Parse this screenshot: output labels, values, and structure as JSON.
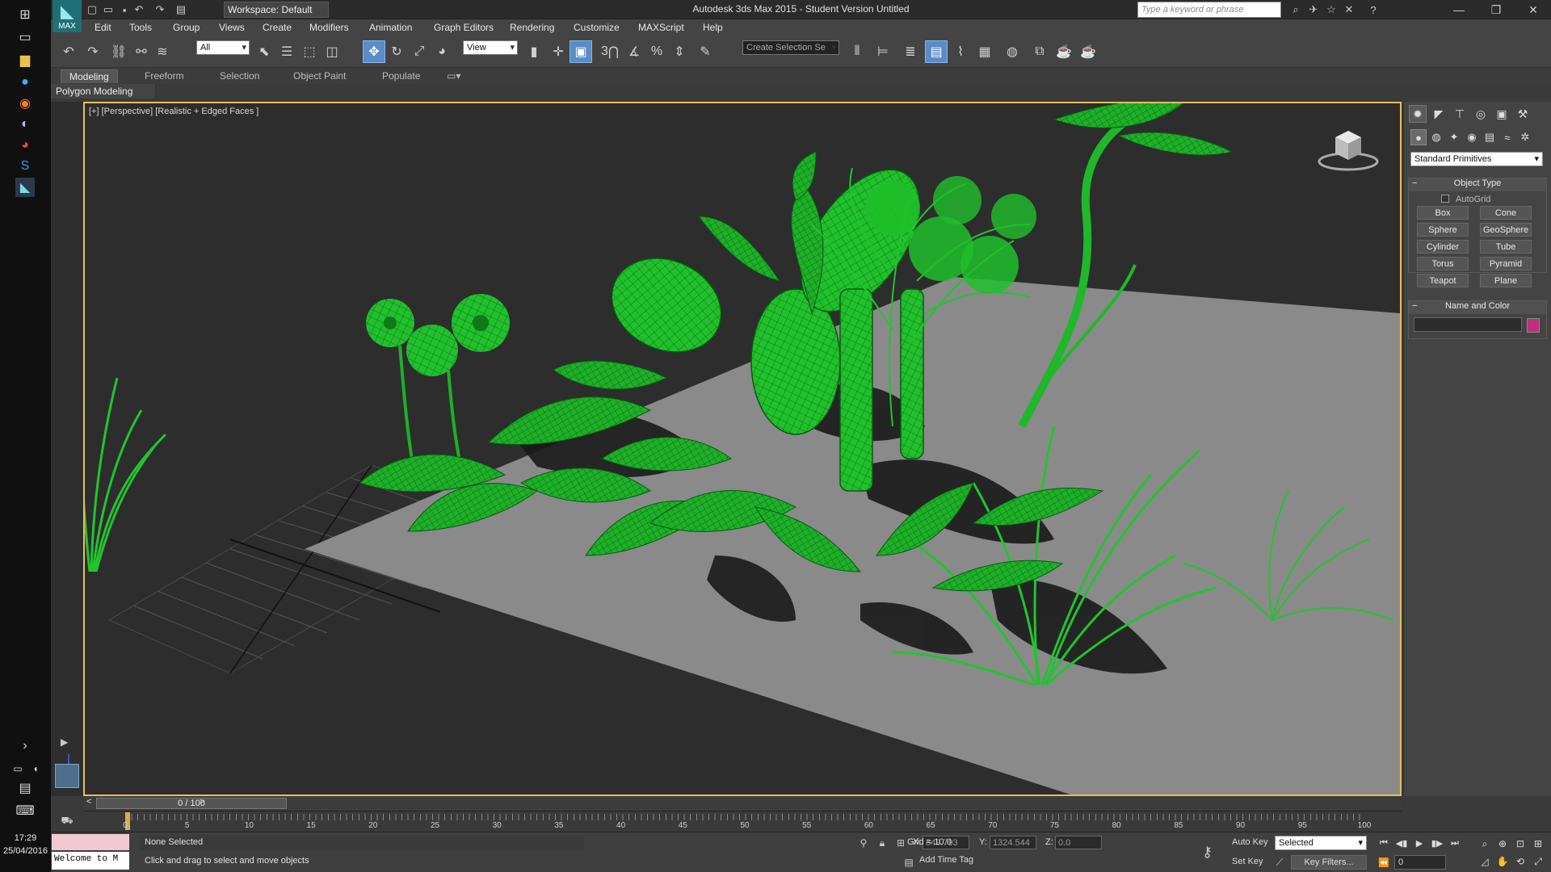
{
  "taskbar": {
    "time": "17:29",
    "date": "25/04/2016"
  },
  "app": {
    "logo_label": "MAX",
    "workspace": "Workspace: Default",
    "window_title": "Autodesk 3ds Max  2015  - Student Version    Untitled",
    "search_placeholder": "Type a keyword or phrase"
  },
  "menu": [
    "Edit",
    "Tools",
    "Group",
    "Views",
    "Create",
    "Modifiers",
    "Animation",
    "Graph Editors",
    "Rendering",
    "Customize",
    "MAXScript",
    "Help"
  ],
  "toolbar": {
    "selection_filter": "All",
    "ref_coord": "View",
    "named_selection": "Create Selection Se",
    "snap_label": "3"
  },
  "ribbon": {
    "tabs": [
      "Modeling",
      "Freeform",
      "Selection",
      "Object Paint",
      "Populate"
    ],
    "panel": "Polygon Modeling"
  },
  "viewport": {
    "label": "[+] [Perspective] [Realistic + Edged Faces ]",
    "viewcube_face": "left"
  },
  "command_panel": {
    "category": "Standard Primitives",
    "object_type_title": "Object Type",
    "autogrid": "AutoGrid",
    "primitives": [
      "Box",
      "Cone",
      "Sphere",
      "GeoSphere",
      "Cylinder",
      "Tube",
      "Torus",
      "Pyramid",
      "Teapot",
      "Plane"
    ],
    "name_color_title": "Name and Color",
    "object_color": "#c0307a"
  },
  "timeline": {
    "frame_display": "0 / 100",
    "ticks": [
      "0",
      "5",
      "10",
      "15",
      "20",
      "25",
      "30",
      "35",
      "40",
      "45",
      "50",
      "55",
      "60",
      "65",
      "70",
      "75",
      "80",
      "85",
      "90",
      "95",
      "100"
    ]
  },
  "status": {
    "maxscript_listener": "Welcome to M",
    "selection": "None Selected",
    "prompt": "Click and drag to select and move objects",
    "x_label": "X:",
    "x_value": "849.793",
    "y_label": "Y:",
    "y_value": "1324.544",
    "z_label": "Z:",
    "z_value": "0.0",
    "grid": "Grid = 10.0",
    "add_time_tag": "Add Time Tag",
    "auto_key": "Auto Key",
    "set_key": "Set Key",
    "key_mode": "Selected",
    "key_filters": "Key Filters...",
    "current_frame": "0"
  },
  "colors": {
    "plant_green": "#1fbf2a",
    "active_viewport_border": "#e3c15a",
    "ground": "#8a8a8a"
  }
}
